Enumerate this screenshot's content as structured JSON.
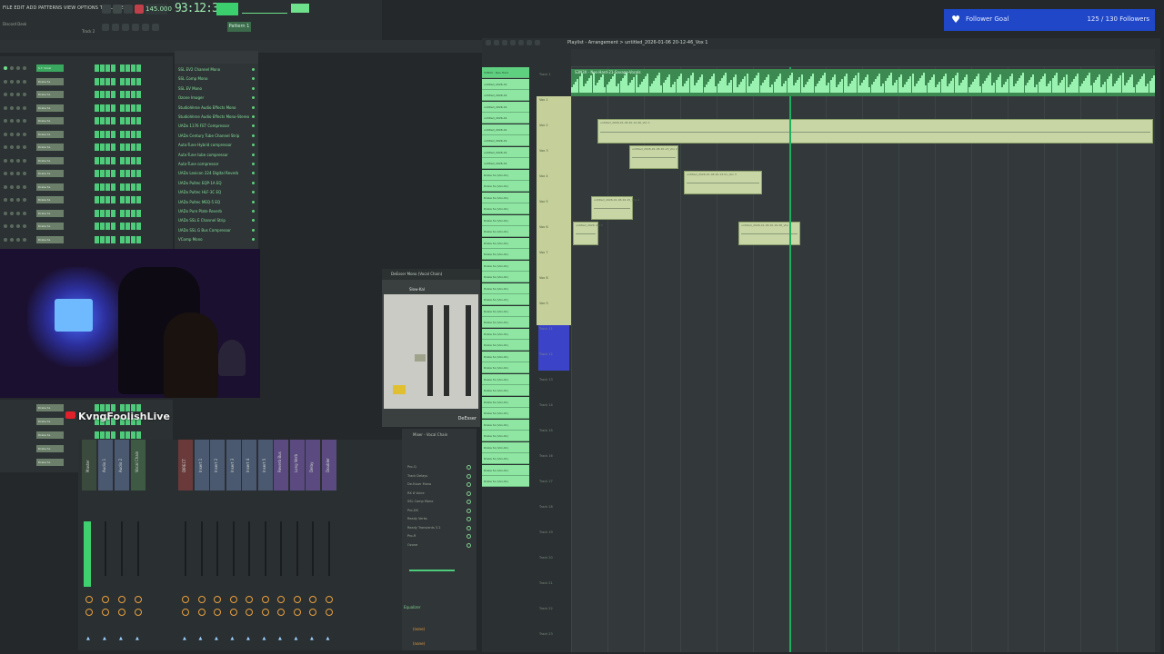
{
  "toolbar": {
    "menu_text": "FILE EDIT ADD PATTERNS VIEW OPTIONS TOOLS HELP",
    "clock": "93:12:32",
    "tempo": "145.000",
    "pattern": "Pattern 1",
    "project_name": "Discord Desk",
    "track_label": "Track 2"
  },
  "follower_goal": {
    "label": "Follower Goal",
    "count": "125 / 130 Followers",
    "accent": "#1f47c8"
  },
  "channel_rack": {
    "rows": [
      "S.T. Vocal",
      "Drake SL",
      "Drake SL",
      "Drake SL",
      "Drake SL",
      "Drake SL",
      "Drake SL",
      "Drake SL",
      "Drake SL",
      "Drake SL",
      "Drake SL",
      "Drake SL",
      "Drake SL",
      "Drake SL"
    ]
  },
  "plugin_browser": {
    "items": [
      "SSL EV2 Channel Mono",
      "SSL Comp Mono",
      "SSL EV Mono",
      "Ozone Imager",
      "StudioVerse Audio Effects Mono",
      "StudioVerse Audio Effects Mono-Stereo",
      "UADx 1176 FET Compressor",
      "UADx Century Tube Channel Strip",
      "Auto-Tune Hybrid compressor",
      "Auto-Tune tube compressor",
      "Auto-Tune compressor",
      "UADx Lexicon 224 Digital Reverb",
      "UADx Pultec EQP-1A EQ",
      "UADx Pultec HLF-3C EQ",
      "UADx Pultec MEQ-5 EQ",
      "UADx Pure Plate Reverb",
      "UADx SSL E Channel Strip",
      "UADx SSL G Bus Compressor",
      "VComp Mono"
    ]
  },
  "streamer": {
    "name": "KvngFoolishLive"
  },
  "mixer": {
    "strips": [
      "Master",
      "Audio 1",
      "Audio 2",
      "Vocal Chain",
      "DIRECT",
      "Insert 1",
      "Insert 2",
      "Insert 3",
      "Insert 4",
      "Insert 5",
      "Reverb Bus",
      "Long Verb",
      "Delay",
      "Doubler"
    ],
    "inserts_title": "Mixer - Vocal Chain",
    "inserts": [
      "Pro-Q",
      "Track Delays",
      "De-Esser Mono",
      "RX 8 Voice",
      "SSL Comp Mono",
      "Pro-DS",
      "Ready Verbs",
      "Ready Transients 3.2",
      "Pro-R",
      "Ozone"
    ],
    "equalizer_label": "Equalizer",
    "send_1": "(none)",
    "send_2": "(none)"
  },
  "deesser": {
    "title": "DeEsser Mono (Vocal Chain)",
    "name": "DeEsser",
    "preset": "Slow-Kal"
  },
  "playlist": {
    "title": "Playlist - Arrangement > untitled_2026-01-06 20-12-46_Vox 1",
    "patterns": [
      "S3N3X - Nes-Hard",
      "untitled_2026-01",
      "untitled_2026-01",
      "untitled_2026-01",
      "untitled_2026-01",
      "untitled_2026-01",
      "untitled_2026-01",
      "untitled_2026-01",
      "untitled_2026-01",
      "Drake SL (Vox-01)",
      "Drake SL (Vox-01)",
      "Drake SL (Vox-01)",
      "Drake SL (Vox-01)",
      "Drake SL (Vox-01)",
      "Drake SL (Vox-01)",
      "Drake SL (Vox-01)",
      "Drake SL (Vox-01)",
      "Drake SL (Vox-01)",
      "Drake SL (Vox-01)",
      "Drake SL (Vox-01)",
      "Drake SL (Vox-01)",
      "Drake SL (Vox-01)",
      "Drake SL (Vox-01)",
      "Drake SL (Vox-01)",
      "Drake SL (Vox-01)",
      "Drake SL (Vox-01)",
      "Drake SL (Vox-01)",
      "Drake SL (Vox-01)",
      "Drake SL (Vox-01)",
      "Drake SL (Vox-01)",
      "Drake SL (Vox-01)",
      "Drake SL (Vox-01)",
      "Drake SL (Vox-01)",
      "Drake SL (Vox-01)",
      "Drake SL (Vox-01)",
      "Drake SL (Vox-01)",
      "Drake SL (Vox-01)"
    ],
    "tracks": [
      "Track 1",
      "Vox 1",
      "Vox 2",
      "Vox 3",
      "Vox 4",
      "Vox 5",
      "Vox 6",
      "Vox 7",
      "Vox 8",
      "Vox 9",
      "Track 11",
      "Track 12",
      "Track 13",
      "Track 14",
      "Track 15",
      "Track 16",
      "Track 17",
      "Track 18",
      "Track 19",
      "Track 20",
      "Track 21",
      "Track 22",
      "Track 23"
    ],
    "audio_clip": "S3N3X - Nes-Hard-21-Savage-Vocals",
    "clips": [
      "untitled_2026-01-06 20-12-46_Vox 1",
      "untitled_2026-01-06 20-13_Vox 2",
      "untitled_2026-01-06 20-13-51_Vox 3",
      "untitled_2026-01-06 20-15_Vox 4",
      "untitled_2026 Vox 5",
      "untitled_2026-01-06 20-16-38_Vox 6"
    ]
  }
}
